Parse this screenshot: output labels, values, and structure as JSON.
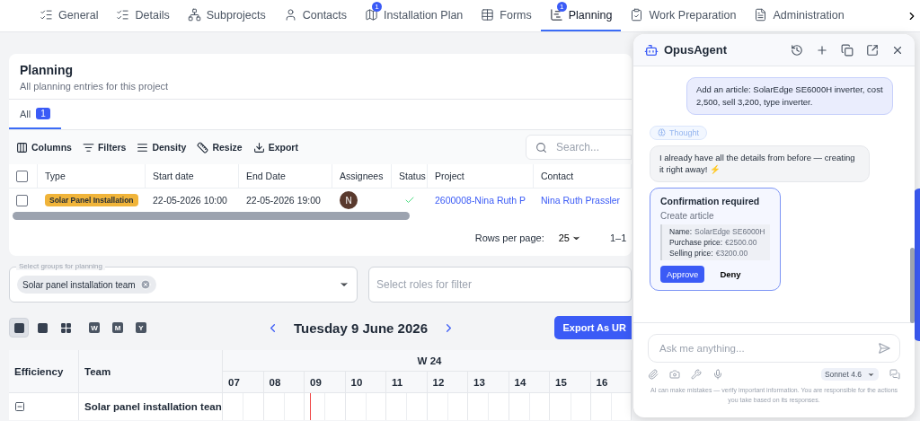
{
  "top_tabs": [
    {
      "kind": "list",
      "label": "General",
      "selected": false
    },
    {
      "kind": "list",
      "label": "Details",
      "selected": false
    },
    {
      "kind": "tree",
      "label": "Subprojects",
      "selected": false
    },
    {
      "kind": "user",
      "label": "Contacts",
      "selected": false
    },
    {
      "kind": "map",
      "label": "Installation Plan",
      "badge": "1",
      "selected": false
    },
    {
      "kind": "table",
      "label": "Forms",
      "selected": false
    },
    {
      "kind": "gantt",
      "label": "Planning",
      "badge": "1",
      "selected": true
    },
    {
      "kind": "clipboard",
      "label": "Work Preparation",
      "selected": false
    },
    {
      "kind": "file",
      "label": "Administration",
      "selected": false
    }
  ],
  "planning": {
    "title": "Planning",
    "subtitle": "All planning entries for this project",
    "tabs": [
      {
        "label": "All",
        "count": "1",
        "selected": true
      }
    ],
    "toolbar": [
      {
        "kind": "columns",
        "label": "Columns"
      },
      {
        "kind": "filters",
        "label": "Filters"
      },
      {
        "kind": "density",
        "label": "Density"
      },
      {
        "kind": "resize",
        "label": "Resize"
      },
      {
        "kind": "export",
        "label": "Export"
      }
    ],
    "search": {
      "placeholder": "Search..."
    },
    "table": {
      "all_checked": false,
      "columns": [
        "Type",
        "Start date",
        "End Date",
        "Assignees",
        "Status",
        "Project",
        "Contact"
      ],
      "rows": [
        {
          "checked": false,
          "type": "Solar Panel Installation",
          "start": "22-05-2026 10:00",
          "end": "22-05-2026 19:00",
          "assignee": "N",
          "done": true,
          "project": "2600008-Nina Ruth P",
          "contact": "Nina Ruth Prassler"
        }
      ]
    },
    "pagination": {
      "label": "Rows per page:",
      "value": "25",
      "range": "1–1"
    }
  },
  "filters": {
    "groups": {
      "label": "Select groups for planning",
      "chips": [
        "Solar panel installation team"
      ]
    },
    "roles": {
      "placeholder": "Select roles for filter"
    }
  },
  "calendar": {
    "views": [
      {
        "kind": "day",
        "selected": true
      },
      {
        "kind": "week",
        "selected": false
      },
      {
        "kind": "month",
        "selected": false
      },
      {
        "kind": "letter",
        "label": "W",
        "selected": false
      },
      {
        "kind": "letter",
        "label": "M",
        "selected": false
      },
      {
        "kind": "letter",
        "label": "Y",
        "selected": false
      }
    ],
    "date": "Tuesday 9 June 2026",
    "export": "Export As UR",
    "columns": [
      "Efficiency",
      "Team"
    ],
    "week": "W 24",
    "days": [
      "07",
      "08",
      "09",
      "10",
      "11",
      "12",
      "13",
      "14",
      "15",
      "16"
    ],
    "groups": [
      {
        "name": "Solar panel installation tean",
        "expanded": true
      }
    ]
  },
  "chat": {
    "title": "OpusAgent",
    "messages": [
      {
        "kind": "user",
        "text": "Add an article: SolarEdge SE6000H inverter, cost 2,500, sell 3,200, type inverter."
      },
      {
        "kind": "thought",
        "text": "Thought"
      },
      {
        "kind": "assistant",
        "text": "I already have all the details from before — creating it right away! ⚡"
      },
      {
        "kind": "confirmation",
        "title": "Confirmation required",
        "action": "Create article",
        "fields": [
          {
            "label": "Name:",
            "value": "SolarEdge SE6000H"
          },
          {
            "label": "Purchase price:",
            "value": "€2500.00"
          },
          {
            "label": "Selling price:",
            "value": "€3200.00"
          }
        ],
        "approve": "Approve",
        "deny": "Deny"
      }
    ],
    "input": {
      "placeholder": "Ask me anything..."
    },
    "model": "Sonnet 4.6",
    "disclaimer": "AI can make mistakes — verify important information. You are responsible for the actions you take based on its responses."
  }
}
